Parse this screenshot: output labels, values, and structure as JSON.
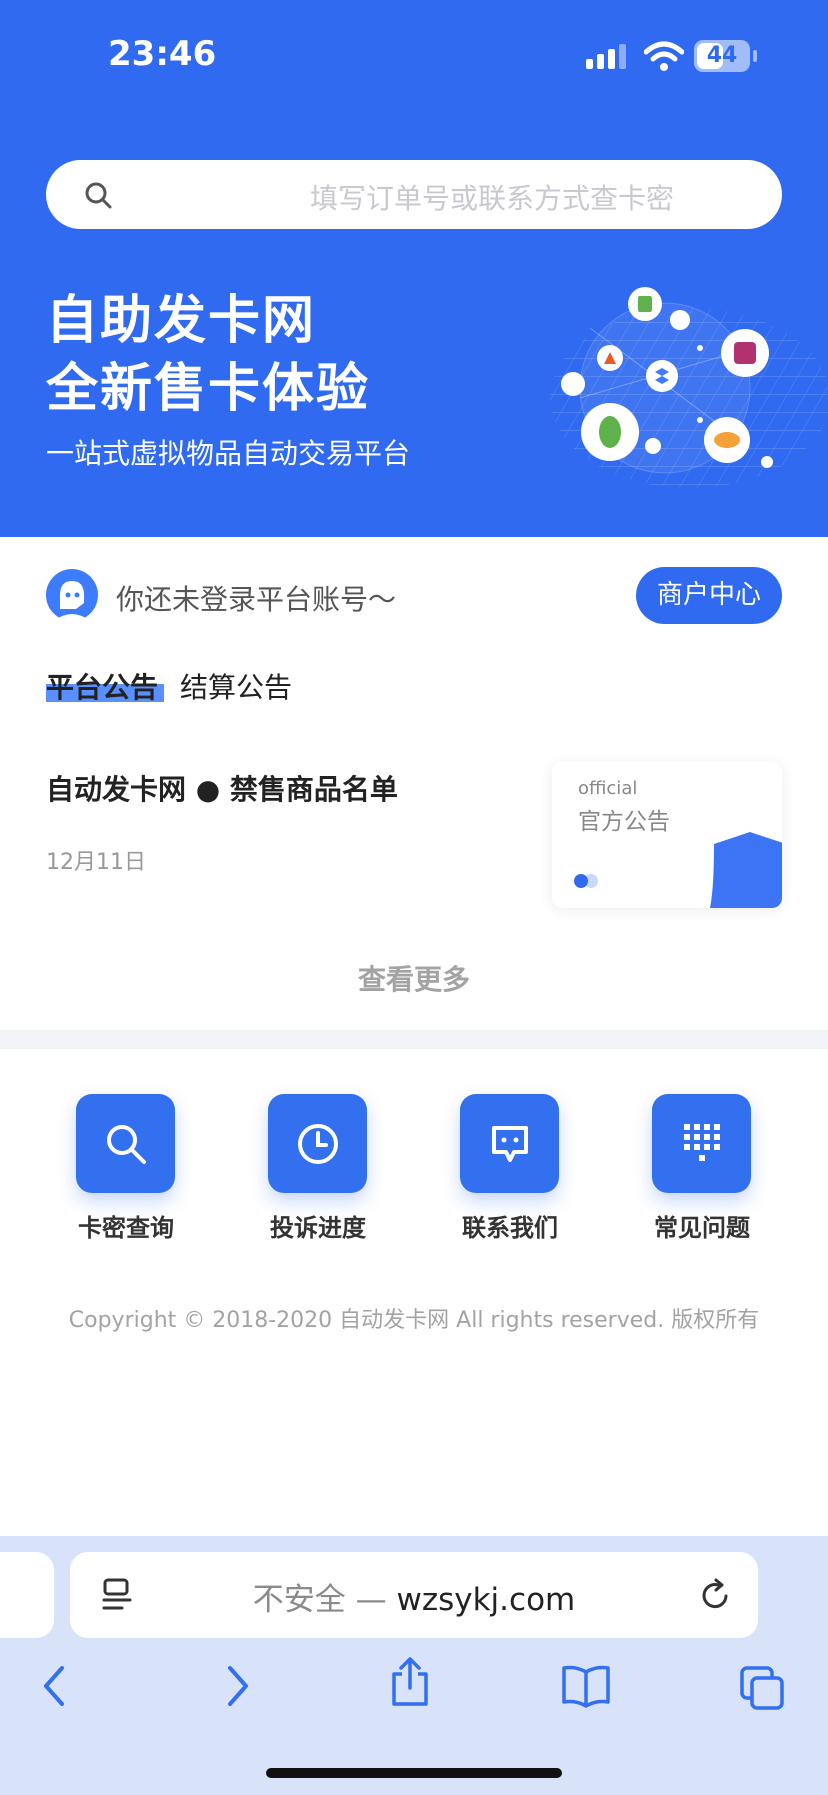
{
  "status_bar": {
    "time": "23:46",
    "battery": "44"
  },
  "search": {
    "placeholder": "填写订单号或联系方式查卡密"
  },
  "hero": {
    "title_line1": "自助发卡网",
    "title_line2": "全新售卡体验",
    "subtitle": "一站式虚拟物品自动交易平台"
  },
  "login": {
    "text": "你还未登录平台账号～",
    "merchant_button": "商户中心"
  },
  "tabs": [
    {
      "label": "平台公告",
      "active": true
    },
    {
      "label": "结算公告",
      "active": false
    }
  ],
  "notice": {
    "title": "自动发卡网 ● 禁售商品名单",
    "date": "12月11日",
    "card_en": "official",
    "card_cn": "官方公告"
  },
  "view_more": "查看更多",
  "grid": [
    {
      "label": "卡密查询",
      "icon": "search-icon"
    },
    {
      "label": "投诉进度",
      "icon": "clock-icon"
    },
    {
      "label": "联系我们",
      "icon": "chat-icon"
    },
    {
      "label": "常见问题",
      "icon": "keypad-icon"
    }
  ],
  "copyright": "Copyright © 2018-2020 自动发卡网 All rights reserved. 版权所有",
  "browser": {
    "insecure": "不安全 — ",
    "domain": "wzsykj.com"
  },
  "colors": {
    "brand_blue": "#2f6af0",
    "icon_blue": "#3370f0",
    "browser_bg": "#d8e3fa"
  }
}
